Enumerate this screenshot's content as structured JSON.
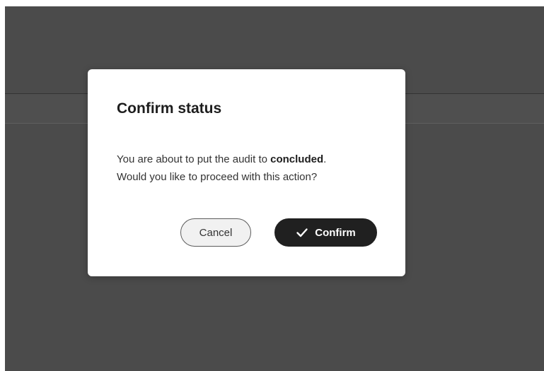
{
  "dialog": {
    "title": "Confirm status",
    "message_prefix": "You are about to put the audit to ",
    "message_status": "concluded",
    "message_suffix": ".",
    "message_line2": "Would you like to proceed with this action?",
    "cancel_label": "Cancel",
    "confirm_label": "Confirm",
    "confirm_icon": "check-icon"
  },
  "colors": {
    "overlay": "#4b4b4b",
    "dialog_bg": "#ffffff",
    "confirm_bg": "#202020",
    "cancel_bg": "#f1f1f1"
  }
}
